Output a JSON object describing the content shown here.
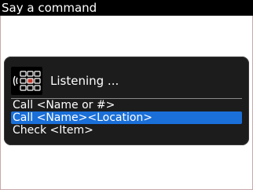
{
  "title_bar": {
    "text": "Say a command"
  },
  "dialog": {
    "icon": "voice-dial-keypad-icon",
    "status_text": "Listening ...",
    "commands": [
      {
        "label": "Call <Name or #>",
        "selected": false
      },
      {
        "label": "Call <Name><Location>",
        "selected": true
      },
      {
        "label": "Check <Item>",
        "selected": false
      }
    ]
  },
  "colors": {
    "title_bar_bg": "#000000",
    "dialog_bg": "#1c1c1c",
    "selection": "#1a6fd8",
    "icon_accent": "#c0392b"
  }
}
